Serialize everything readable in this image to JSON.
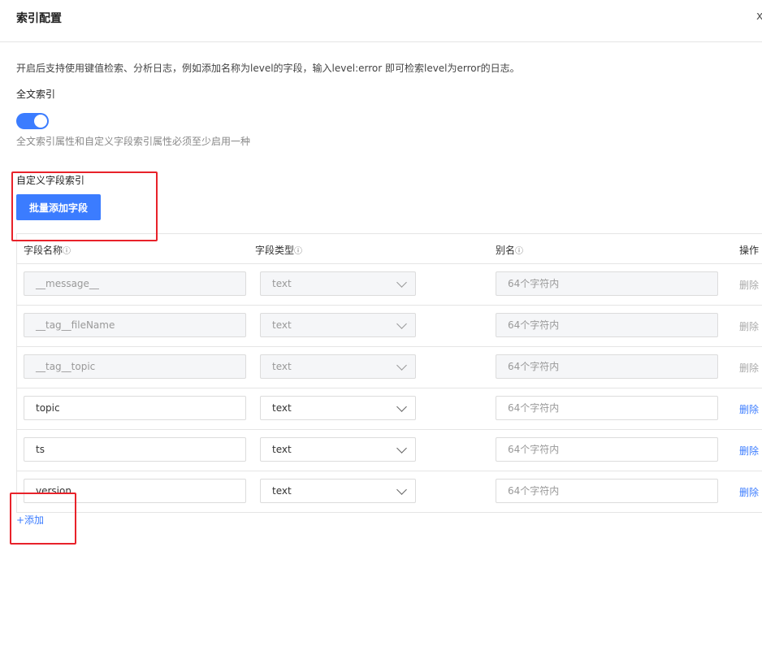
{
  "header": {
    "title": "索引配置",
    "close_glyph": "x"
  },
  "description": "开启后支持使用键值检索、分析日志，例如添加名称为level的字段，输入level:error 即可检索level为error的日志。",
  "fulltext": {
    "label": "全文索引",
    "enabled": true,
    "hint": "全文索引属性和自定义字段索引属性必须至少启用一种"
  },
  "custom_index": {
    "label": "自定义字段索引",
    "batch_add_label": "批量添加字段"
  },
  "table": {
    "columns": {
      "name": "字段名称",
      "type": "字段类型",
      "alias": "别名",
      "op": "操作"
    },
    "info_glyph": "ⓘ",
    "rows": [
      {
        "name": "__message__",
        "type": "text",
        "alias_placeholder": "64个字符内",
        "op": "删除",
        "disabled": true
      },
      {
        "name": "__tag__fileName",
        "type": "text",
        "alias_placeholder": "64个字符内",
        "op": "删除",
        "disabled": true
      },
      {
        "name": "__tag__topic",
        "type": "text",
        "alias_placeholder": "64个字符内",
        "op": "删除",
        "disabled": true
      },
      {
        "name": "topic",
        "type": "text",
        "alias_placeholder": "64个字符内",
        "op": "删除",
        "disabled": false
      },
      {
        "name": "ts",
        "type": "text",
        "alias_placeholder": "64个字符内",
        "op": "删除",
        "disabled": false
      },
      {
        "name": "version",
        "type": "text",
        "alias_placeholder": "64个字符内",
        "op": "删除",
        "disabled": false
      }
    ]
  },
  "add_label": "+添加",
  "colors": {
    "accent": "#3b7cff",
    "annotation": "#e8222a"
  }
}
